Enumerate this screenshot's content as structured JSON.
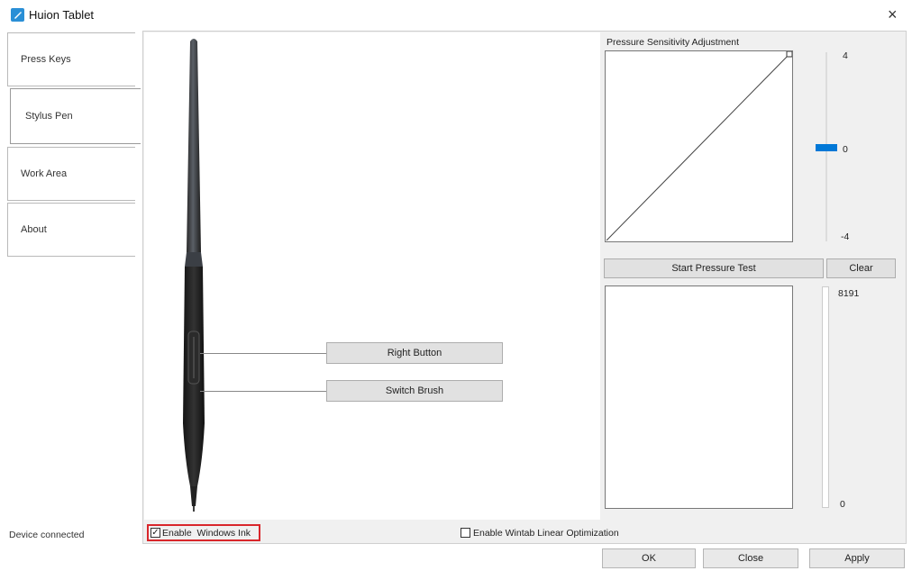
{
  "window": {
    "title": "Huion Tablet",
    "close_glyph": "×",
    "icon": "huion-pen-icon"
  },
  "tabs": [
    {
      "label": "Press Keys"
    },
    {
      "label": "Stylus Pen",
      "selected": true
    },
    {
      "label": "Work Area"
    },
    {
      "label": "About"
    }
  ],
  "pen": {
    "right_button_label": "Right Button",
    "switch_brush_label": "Switch Brush"
  },
  "pressure": {
    "title": "Pressure Sensitivity Adjustment",
    "slider_max": "4",
    "slider_mid": "0",
    "slider_min": "-4",
    "slider_value": 0,
    "start_test_label": "Start Pressure Test",
    "clear_label": "Clear",
    "test_max": "8191",
    "test_min": "0",
    "accent": "#0078d7"
  },
  "options": {
    "windows_ink_label": "Enable  Windows Ink",
    "windows_ink_checked": true,
    "wintab_label": "Enable Wintab Linear Optimization",
    "wintab_checked": false
  },
  "status": {
    "text": "Device connected"
  },
  "footer": {
    "ok_label": "OK",
    "close_label": "Close",
    "apply_label": "Apply"
  }
}
